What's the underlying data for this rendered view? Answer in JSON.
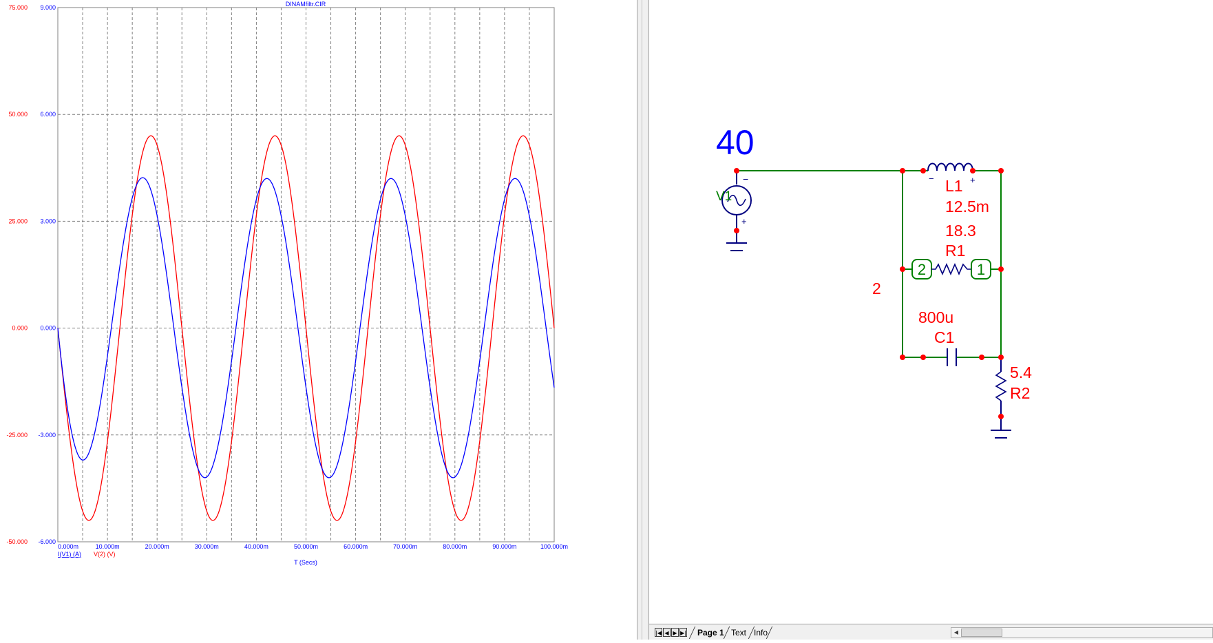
{
  "plot": {
    "title": "DINAMfiltr.CIR",
    "xlabel": "T (Secs)",
    "legend": [
      "I(V1) (A)",
      "V(2) (V)"
    ],
    "left_ticks": [
      "75.000",
      "50.000",
      "25.000",
      "0.000",
      "-25.000",
      "-50.000"
    ],
    "right_ticks": [
      "9.000",
      "6.000",
      "3.000",
      "0.000",
      "-3.000",
      "-6.000"
    ],
    "x_ticks": [
      "0.000m",
      "10.000m",
      "20.000m",
      "30.000m",
      "40.000m",
      "50.000m",
      "60.000m",
      "70.000m",
      "80.000m",
      "90.000m",
      "100.000m"
    ]
  },
  "chart_data": {
    "type": "line",
    "title": "DINAMfiltr.CIR",
    "xlabel": "T (Secs)",
    "ylabel": "",
    "x_unit": "s",
    "xlim": [
      0,
      0.1
    ],
    "ylim_left": [
      -50,
      75
    ],
    "ylim_right": [
      -6,
      9
    ],
    "grid": true,
    "series": [
      {
        "name": "V(2) (V)",
        "color": "#ff0000",
        "axis": "left",
        "amplitude": 45,
        "frequency_hz": 40,
        "phase_rad": 3.1416,
        "note_peak_time_s": 0.0188
      },
      {
        "name": "I(V1) (A)",
        "color": "#0000ff",
        "axis": "right",
        "amplitude": 4.2,
        "frequency_hz": 40,
        "phase_rad": 3.55,
        "transient": "starts from 0"
      }
    ]
  },
  "schematic": {
    "frequency": "40",
    "v1_label": "V1",
    "v1_minus": "−",
    "v1_plus": "+",
    "l1_label": "L1",
    "l1_value": "12.5m",
    "l1_minus": "−",
    "l1_plus": "+",
    "r1_value": "18.3",
    "r1_label": "R1",
    "r1_pin2": "2",
    "r1_pin1": "1",
    "node_label": "2",
    "c1_value": "800u",
    "c1_label": "C1",
    "r2_value": "5.4",
    "r2_label": "R2"
  },
  "tabs": {
    "page1": "Page 1",
    "text": "Text",
    "info": "Info"
  },
  "colors": {
    "red_trace": "#ff0000",
    "blue_trace": "#0000ff",
    "wire": "#008000",
    "component": "#000080",
    "node": "#ff0000"
  }
}
